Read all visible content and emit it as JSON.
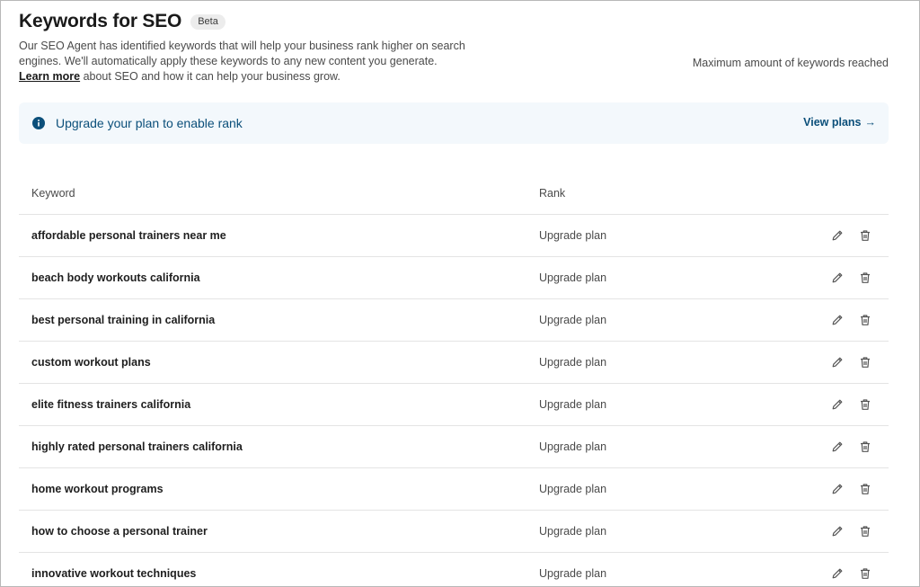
{
  "header": {
    "title": "Keywords for SEO",
    "badge": "Beta",
    "description_line1": "Our SEO Agent has identified keywords that will help your business rank higher on search",
    "description_line2": "engines. We'll automatically apply these keywords to any new content you generate.",
    "learn_more_label": "Learn more",
    "description_line3_rest": " about SEO and how it can help your business grow.",
    "max_note": "Maximum amount of keywords reached"
  },
  "banner": {
    "icon": "info-icon",
    "text": "Upgrade your plan to enable rank",
    "link_label": "View plans",
    "link_arrow": "→"
  },
  "table": {
    "columns": [
      "Keyword",
      "Rank"
    ],
    "rows": [
      {
        "keyword": "affordable personal trainers near me",
        "rank": "Upgrade plan"
      },
      {
        "keyword": "beach body workouts california",
        "rank": "Upgrade plan"
      },
      {
        "keyword": "best personal training in california",
        "rank": "Upgrade plan"
      },
      {
        "keyword": "custom workout plans",
        "rank": "Upgrade plan"
      },
      {
        "keyword": "elite fitness trainers california",
        "rank": "Upgrade plan"
      },
      {
        "keyword": "highly rated personal trainers california",
        "rank": "Upgrade plan"
      },
      {
        "keyword": "home workout programs",
        "rank": "Upgrade plan"
      },
      {
        "keyword": "how to choose a personal trainer",
        "rank": "Upgrade plan"
      },
      {
        "keyword": "innovative workout techniques",
        "rank": "Upgrade plan"
      }
    ],
    "row_actions": [
      "pencil-icon",
      "trash-icon"
    ]
  },
  "colors": {
    "accent": "#0b4f7a",
    "banner_bg": "#f3f8fc",
    "divider": "#e4e4e4"
  }
}
